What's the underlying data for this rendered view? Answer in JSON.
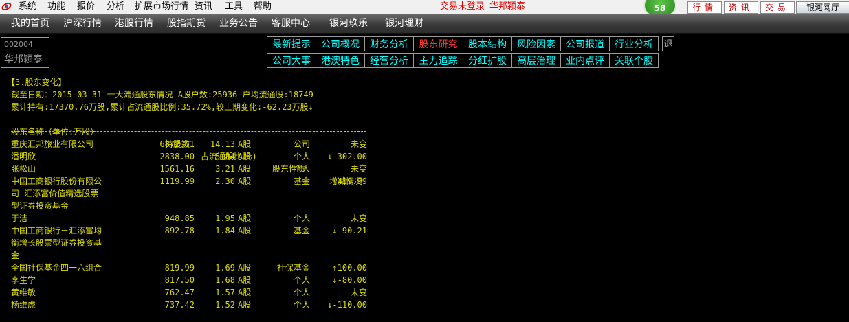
{
  "menubar": {
    "items": [
      "系统",
      "功能",
      "报价",
      "分析",
      "扩展市场行情",
      "资讯",
      "工具",
      "帮助"
    ],
    "login_status": "交易未登录",
    "broker": "华邦颖泰",
    "notify_count": "58",
    "buttons": [
      "行情",
      "资讯",
      "交易"
    ],
    "hall_button": "银河网厅",
    "logo_icon": "galaxy-logo-icon"
  },
  "navbar": {
    "items": [
      "我的首页",
      "沪深行情",
      "港股行情",
      "股指期货",
      "业务公告",
      "客服中心",
      "银河玖乐",
      "银河理财"
    ]
  },
  "stock": {
    "code": "002004",
    "name": "华邦颖泰"
  },
  "tabs": {
    "row1": [
      "最新提示",
      "公司概况",
      "财务分析",
      "股东研究",
      "股本结构",
      "风险因素",
      "公司报道",
      "行业分析"
    ],
    "row2": [
      "公司大事",
      "港澳特色",
      "经营分析",
      "主力追踪",
      "分红扩股",
      "高层治理",
      "业内点评",
      "关联个股"
    ],
    "active": "股东研究",
    "exit": "退"
  },
  "content": {
    "section_title": "【3.股东变化】",
    "summary_line1": "截至日期：2015-03-31 十大流通股东情况 A股户数:25936 户均流通股:18749",
    "summary_line2": "累计持有:17370.76万股,累计占流通股比例:35.72%,较上期变化:-62.23万股↓",
    "columns": {
      "name": "股东名称（单位:万股）",
      "shares": "持股数",
      "ratio": "占流通股比(%)",
      "nature": "股东性质",
      "change": "增减情况"
    },
    "rows": [
      {
        "name": "重庆汇邦旅业有限公司",
        "shares": "6872.61",
        "ratio": "14.13",
        "class": "A股",
        "nature": "公司",
        "change": "未变"
      },
      {
        "name": "潘明欣",
        "shares": "2838.00",
        "ratio": "5.84",
        "class": "A股",
        "nature": "个人",
        "change": "↓-302.00"
      },
      {
        "name": "张松山",
        "shares": "1561.16",
        "ratio": "3.21",
        "class": "A股",
        "nature": "个人",
        "change": "未变"
      },
      {
        "name": "中国工商银行股份有限公\n司-汇添富价值精选股票\n型证券投资基金",
        "shares": "1119.99",
        "ratio": "2.30",
        "class": "A股",
        "nature": "基金",
        "change": "↑419.99"
      },
      {
        "name": "于洁",
        "shares": "948.85",
        "ratio": "1.95",
        "class": "A股",
        "nature": "个人",
        "change": "未变"
      },
      {
        "name": "中国工商银行－汇添富均\n衡增长股票型证券投资基\n金",
        "shares": "892.78",
        "ratio": "1.84",
        "class": "A股",
        "nature": "基金",
        "change": "↓-90.21"
      },
      {
        "name": "全国社保基金四一六组合",
        "shares": "819.99",
        "ratio": "1.69",
        "class": "A股",
        "nature": "社保基金",
        "change": "↑100.00"
      },
      {
        "name": "李生学",
        "shares": "817.50",
        "ratio": "1.68",
        "class": "A股",
        "nature": "个人",
        "change": "↓-80.00"
      },
      {
        "name": "黄维敏",
        "shares": "762.47",
        "ratio": "1.57",
        "class": "A股",
        "nature": "个人",
        "change": "未变"
      },
      {
        "name": "杨维虎",
        "shares": "737.42",
        "ratio": "1.52",
        "class": "A股",
        "nature": "个人",
        "change": "↓-110.00"
      }
    ]
  }
}
